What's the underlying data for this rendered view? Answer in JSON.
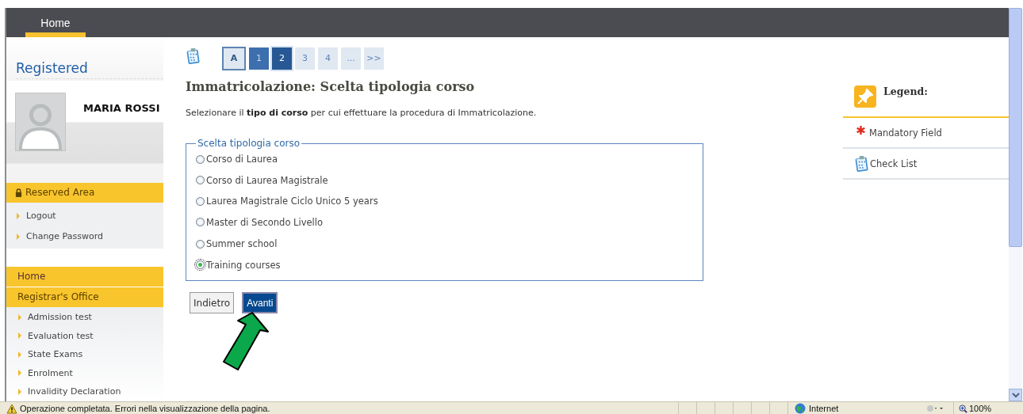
{
  "top_nav": {
    "tabs": [
      {
        "label": "Home",
        "selected": true
      }
    ]
  },
  "sidebar": {
    "title": "Registered",
    "user_name": "MARIA ROSSI",
    "sections": [
      {
        "header": "Reserved Area",
        "kind": "locked",
        "items": [
          "Logout",
          "Change Password"
        ]
      },
      {
        "header": "Home",
        "kind": "plain"
      },
      {
        "header": "Registrar's Office",
        "kind": "plain",
        "items": [
          "Admission test",
          "Evaluation test",
          "State Exams",
          "Enrolment",
          "Invalidity Declaration"
        ]
      }
    ]
  },
  "steps": [
    {
      "label": "A",
      "kind": "start",
      "selected": false
    },
    {
      "label": "1",
      "kind": "done",
      "selected": false
    },
    {
      "label": "2",
      "kind": "done",
      "selected": true
    },
    {
      "label": "3",
      "kind": "todo",
      "selected": false
    },
    {
      "label": "4",
      "kind": "todo",
      "selected": false
    },
    {
      "label": "...",
      "kind": "todo",
      "selected": false
    },
    {
      "label": ">>",
      "kind": "todo",
      "selected": false
    }
  ],
  "page_title": "Immatricolazione: Scelta tipologia corso",
  "description": "Selezionare il **tipo di corso** per cui effettuare la procedura di Immatricolazione.",
  "course_type": {
    "legend": "Scelta tipologia corso",
    "options": [
      {
        "label": "Corso di Laurea",
        "selected": false
      },
      {
        "label": "Corso di Laurea Magistrale",
        "selected": false
      },
      {
        "label": "Laurea Magistrale Ciclo Unico 5 years",
        "selected": false
      },
      {
        "label": "Master di Secondo Livello",
        "selected": false
      },
      {
        "label": "Summer school",
        "selected": false
      },
      {
        "label": "Training courses",
        "selected": true
      }
    ]
  },
  "buttons": [
    {
      "label": "Indietro",
      "kind": "secondary"
    },
    {
      "label": "Avanti",
      "kind": "primary"
    }
  ],
  "legend": {
    "title": "Legend:",
    "items": [
      {
        "label": "Mandatory Field",
        "kind": "asterisk"
      },
      {
        "label": "Check List",
        "kind": "checklist"
      }
    ]
  },
  "status_bar": {
    "message": "Operazione completata. Errori nella visualizzazione della pagina.",
    "zone": "Internet",
    "zoom": "100%"
  }
}
